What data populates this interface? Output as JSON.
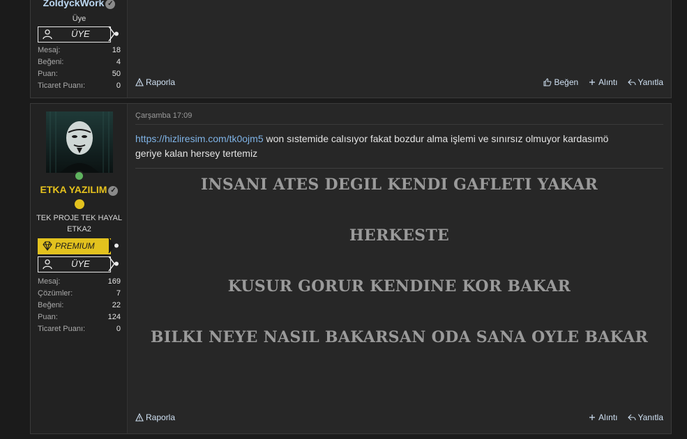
{
  "posts": [
    {
      "user": {
        "name": "ZoldyckWork",
        "title": "Üye",
        "verified_icon": "verified-check-icon",
        "name_color": "#bcd8f2"
      },
      "badges": [
        {
          "label": "ÜYE",
          "icon": "user-icon"
        }
      ],
      "stats": [
        {
          "key": "Mesaj:",
          "value": "18"
        },
        {
          "key": "Beğeni:",
          "value": "4"
        },
        {
          "key": "Puan:",
          "value": "50"
        },
        {
          "key": "Ticaret Puanı:",
          "value": "0"
        }
      ],
      "actions": {
        "report": "Raporla",
        "like": "Beğen",
        "quote": "Alıntı",
        "reply": "Yanıtla"
      }
    },
    {
      "user": {
        "name": "ETKA YAZILIM",
        "title": "TEK PROJE TEK HAYAL ETKA2",
        "verified_icon": "verified-check-icon",
        "name_color": "#e6c21d",
        "online_color": "#5fb35f"
      },
      "badges": [
        {
          "label": "PREMIUM ÜYE",
          "icon": "diamond-icon",
          "color": "#e3c21e"
        },
        {
          "label": "ÜYE",
          "icon": "user-icon"
        }
      ],
      "stats": [
        {
          "key": "Mesaj:",
          "value": "169"
        },
        {
          "key": "Çözümler:",
          "value": "7"
        },
        {
          "key": "Beğeni:",
          "value": "22"
        },
        {
          "key": "Puan:",
          "value": "124"
        },
        {
          "key": "Ticaret Puanı:",
          "value": "0"
        }
      ],
      "date": "Çarşamba 17:09",
      "message": {
        "link": "https://hizliresim.com/tk0ojm5",
        "text": "won sıstemide calısıyor fakat bozdur alma işlemi ve sınırsız olmuyor kardasımö",
        "text2": "geriye kalan hersey tertemiz"
      },
      "signature": [
        "INSANI ATES DEGIL KENDI GAFLETI YAKAR",
        "HERKESTE",
        "KUSUR GORUR KENDINE KOR BAKAR",
        "BILKI NEYE NASIL BAKARSAN ODA SANA OYLE BAKAR"
      ],
      "actions": {
        "report": "Raporla",
        "quote": "Alıntı",
        "reply": "Yanıtla"
      }
    }
  ],
  "colors": {
    "link": "#7fb3e6",
    "action": "#cfe0f2",
    "premium": "#e3c21e"
  }
}
